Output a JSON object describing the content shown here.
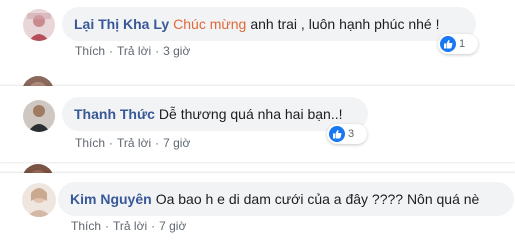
{
  "comments": [
    {
      "name": "Lại Thị Kha Ly",
      "tag": "Chúc mừng",
      "text": "anh trai , luôn hạnh phúc nhé !",
      "like_label": "Thích",
      "reply_label": "Trả lời",
      "time": "3 giờ",
      "reaction_count": "1",
      "reaction_icon": "like-icon",
      "avatar_color": "#c9a3a8"
    },
    {
      "name": "Thanh Thức",
      "text": "Dễ thương quá nha hai bạn..!",
      "like_label": "Thích",
      "reply_label": "Trả lời",
      "time": "7 giờ",
      "reaction_count": "3",
      "reaction_icon": "like-icon",
      "avatar_color": "#3b3f46"
    },
    {
      "name": "Kim Nguyên",
      "text": "Oa bao h e di dam cưới của a đây ???? Nôn quá nè",
      "like_label": "Thích",
      "reply_label": "Trả lời",
      "time": "7 giờ",
      "avatar_color": "#d9c7bd"
    }
  ],
  "separators": {
    "dot": "·"
  },
  "colors": {
    "name": "#385898",
    "tag": "#e0693a",
    "bubble": "#f2f3f5",
    "like_badge": "#1877f2"
  }
}
